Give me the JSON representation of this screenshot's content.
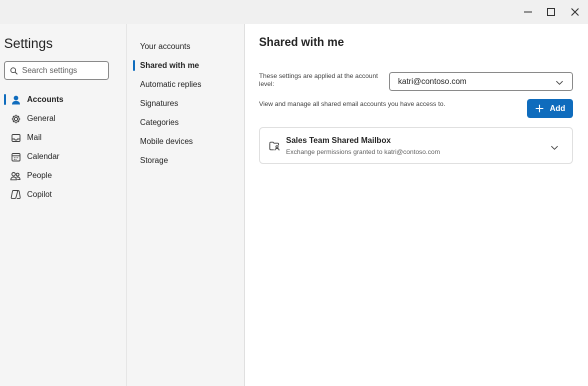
{
  "window": {
    "minimize_icon": "minimize-icon",
    "maximize_icon": "maximize-icon",
    "close_icon": "close-icon"
  },
  "sidebar": {
    "title": "Settings",
    "search_placeholder": "Search settings",
    "items": [
      {
        "label": "Accounts",
        "icon": "person-icon",
        "active": true
      },
      {
        "label": "General",
        "icon": "gear-icon",
        "active": false
      },
      {
        "label": "Mail",
        "icon": "mail-icon",
        "active": false
      },
      {
        "label": "Calendar",
        "icon": "calendar-icon",
        "active": false
      },
      {
        "label": "People",
        "icon": "people-icon",
        "active": false
      },
      {
        "label": "Copilot",
        "icon": "copilot-icon",
        "active": false
      }
    ]
  },
  "subnav": {
    "items": [
      {
        "label": "Your accounts",
        "active": false
      },
      {
        "label": "Shared with me",
        "active": true
      },
      {
        "label": "Automatic replies",
        "active": false
      },
      {
        "label": "Signatures",
        "active": false
      },
      {
        "label": "Categories",
        "active": false
      },
      {
        "label": "Mobile devices",
        "active": false
      },
      {
        "label": "Storage",
        "active": false
      }
    ]
  },
  "main": {
    "title": "Shared with me",
    "applied_text": "These settings are applied at the account level:",
    "account_value": "katri@contoso.com",
    "manage_text": "View and manage all shared email accounts you have access to.",
    "add_label": "Add",
    "mailbox": {
      "name": "Sales Team Shared Mailbox",
      "subtitle": "Exchange permissions granted to katri@contoso.com"
    }
  },
  "colors": {
    "accent": "#0f6cbd",
    "pane_bg": "#f5f5f5",
    "content_bg": "#ffffff"
  }
}
